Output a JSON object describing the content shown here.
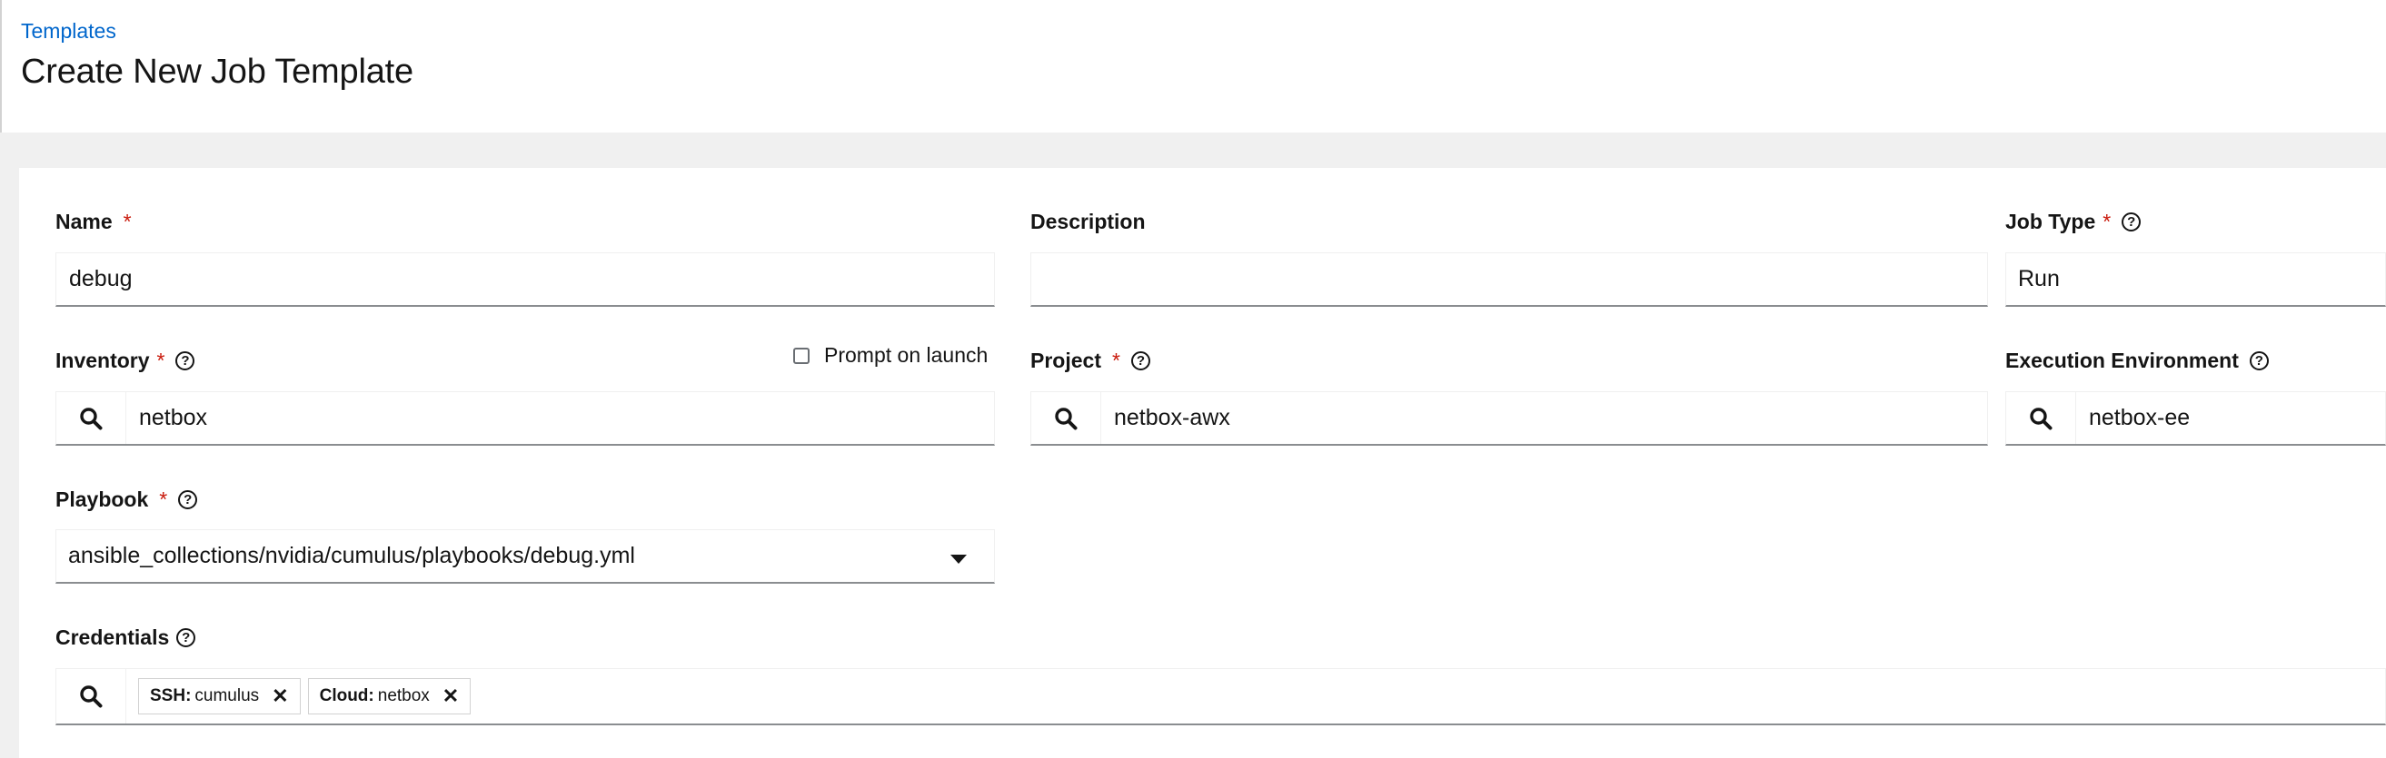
{
  "breadcrumb": {
    "label": "Templates"
  },
  "page": {
    "title": "Create New Job Template"
  },
  "form": {
    "name": {
      "label": "Name",
      "required": "*",
      "value": "debug"
    },
    "description": {
      "label": "Description",
      "value": ""
    },
    "job_type": {
      "label": "Job Type",
      "required": "*",
      "value": "Run"
    },
    "inventory": {
      "label": "Inventory",
      "required": "*",
      "value": "netbox",
      "prompt_label": "Prompt on launch",
      "prompt_checked": false
    },
    "project": {
      "label": "Project",
      "required": "*",
      "value": "netbox-awx"
    },
    "execution_environment": {
      "label": "Execution Environment",
      "value": "netbox-ee"
    },
    "playbook": {
      "label": "Playbook",
      "required": "*",
      "value": "ansible_collections/nvidia/cumulus/playbooks/debug.yml"
    },
    "credentials": {
      "label": "Credentials",
      "chips": [
        {
          "type": "SSH:",
          "name": "cumulus"
        },
        {
          "type": "Cloud:",
          "name": "netbox"
        }
      ]
    }
  },
  "icons": {
    "help": "question-circle-icon",
    "search": "search-icon",
    "remove": "times-icon",
    "dropdown": "caret-down-icon"
  },
  "colors": {
    "link": "#0066cc",
    "required": "#c9190b",
    "background": "#f0f0f0"
  }
}
